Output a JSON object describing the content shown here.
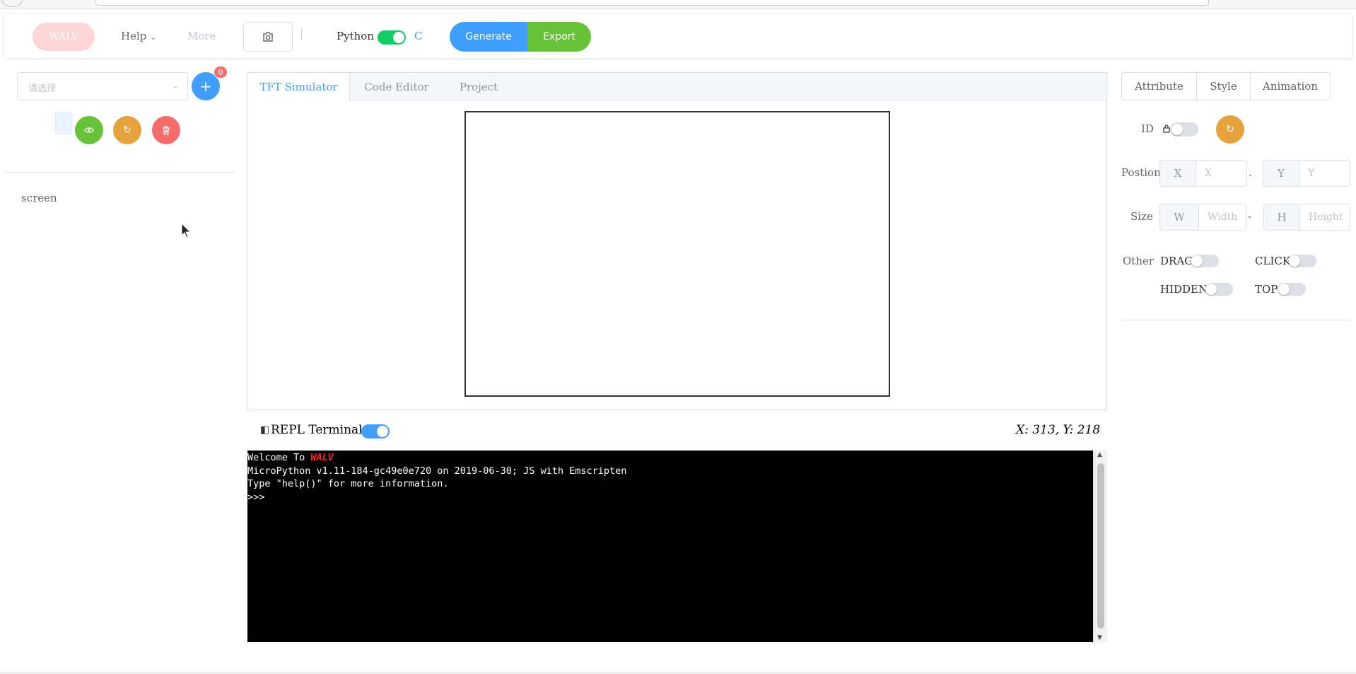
{
  "toolbar": {
    "brand_label": "WALV",
    "help_label": "Help",
    "more_label": "More",
    "python_label": "Python",
    "c_label": "C",
    "generate_label": "Generate",
    "export_label": "Export",
    "language_toggle_on": true
  },
  "left_panel": {
    "select_placeholder": "请选择",
    "add_badge_count": "0",
    "tree": [
      "screen"
    ]
  },
  "center": {
    "tabs": [
      {
        "label": "TFT Simulator",
        "active": true
      },
      {
        "label": "Code Editor",
        "active": false
      },
      {
        "label": "Project",
        "active": false
      }
    ]
  },
  "repl": {
    "label": "REPL Terminal",
    "enabled": true,
    "coords": "X: 313, Y: 218",
    "welcome_prefix": "Welcome To ",
    "welcome_brand": "WALV",
    "line2": "MicroPython v1.11-184-gc49e0e720 on 2019-06-30; JS with Emscripten",
    "line3": "Type \"help()\" for more information.",
    "prompt": ">>>"
  },
  "right_panel": {
    "tabs": [
      "Attribute",
      "Style",
      "Animation"
    ],
    "id_label": "ID",
    "position_label": "Postion",
    "x_prefix": "X",
    "x_placeholder": "X",
    "y_prefix": "Y",
    "y_placeholder": "Y",
    "size_label": "Size",
    "w_prefix": "W",
    "w_placeholder": "Width",
    "h_prefix": "H",
    "h_placeholder": "Height",
    "other_label": "Other",
    "drag_label": "DRAG",
    "click_label": "CLICK",
    "hidden_label": "HIDDEN",
    "top_label": "TOP"
  },
  "colors": {
    "primary": "#409eff",
    "success": "#67c23a",
    "warning": "#e6a23c",
    "danger": "#f56c6c",
    "toggle_green": "#13ce66"
  },
  "icons": {
    "camera": "camera-icon",
    "add": "plus-icon",
    "view": "eye-icon",
    "refresh": "refresh-icon",
    "delete": "trash-icon",
    "lock": "lock-icon",
    "terminal": "terminal-icon"
  }
}
